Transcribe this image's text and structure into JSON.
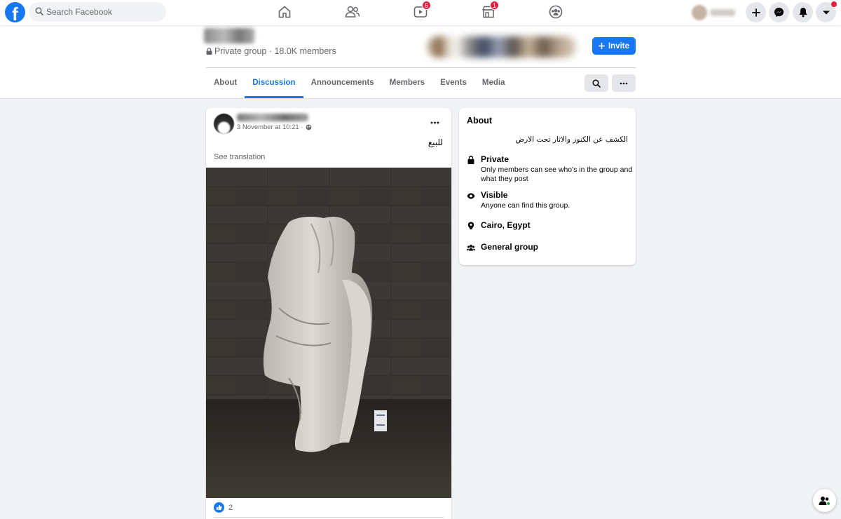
{
  "topnav": {
    "logo": "f",
    "search_placeholder": "Search Facebook",
    "tabs": [
      {
        "name": "home",
        "icon": "home-icon",
        "badge": null
      },
      {
        "name": "friends",
        "icon": "friends-icon",
        "badge": null
      },
      {
        "name": "watch",
        "icon": "video-icon",
        "badge": "5"
      },
      {
        "name": "marketplace",
        "icon": "shop-icon",
        "badge": "1"
      },
      {
        "name": "groups",
        "icon": "groups-icon",
        "badge": null
      }
    ],
    "right_buttons": [
      "plus-icon",
      "messenger-icon",
      "bell-icon",
      "dropdown-icon"
    ]
  },
  "group": {
    "privacy_label": "Private group · 18.0K members",
    "invite_label": "Invite",
    "tabs": [
      "About",
      "Discussion",
      "Announcements",
      "Members",
      "Events",
      "Media"
    ],
    "active_tab": "Discussion"
  },
  "post": {
    "timestamp": "3 November at 10:21 ·",
    "text": "للبيع",
    "see_translation": "See translation",
    "reaction_count": "2"
  },
  "about": {
    "title": "About",
    "description": "الكشف عن الكنوز والاثار تحت الارض",
    "items": [
      {
        "icon": "lock-icon",
        "title": "Private",
        "subtitle": "Only members can see who's in the group and what they post"
      },
      {
        "icon": "eye-icon",
        "title": "Visible",
        "subtitle": "Anyone can find this group."
      },
      {
        "icon": "location-pin-icon",
        "title": "Cairo, Egypt",
        "subtitle": ""
      },
      {
        "icon": "people-icon",
        "title": "General group",
        "subtitle": ""
      }
    ]
  },
  "colors": {
    "brand": "#1877f2",
    "badge": "#e41e3f",
    "background": "#f0f2f5",
    "secondary_text": "#65676b"
  }
}
